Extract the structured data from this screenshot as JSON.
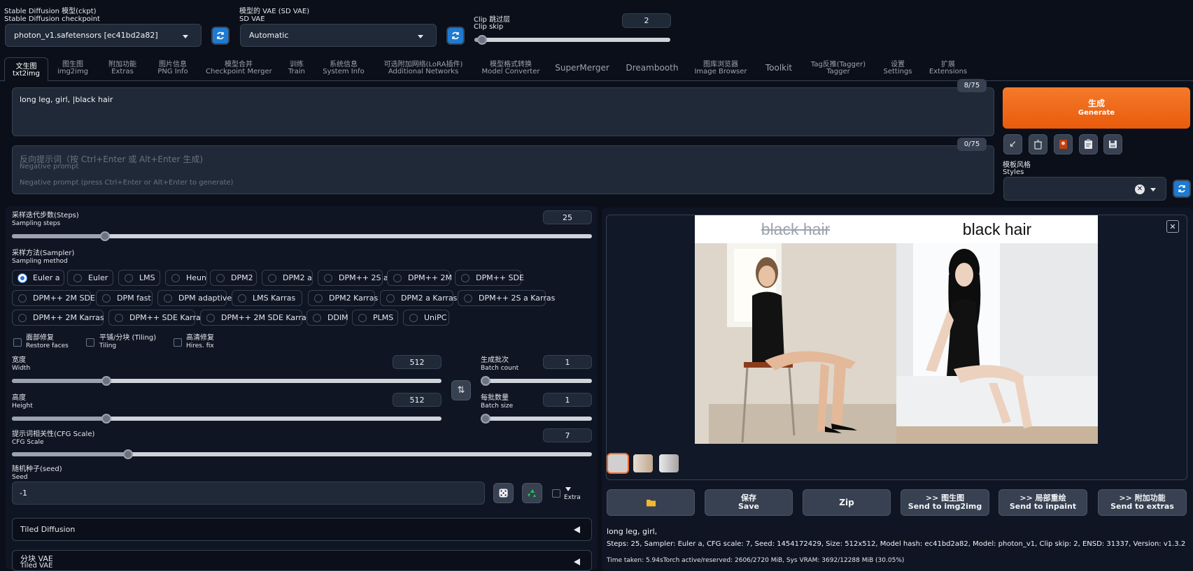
{
  "checkpoint": {
    "label_cn": "Stable Diffusion 模型(ckpt)",
    "label_en": "Stable Diffusion checkpoint",
    "value": "photon_v1.safetensors [ec41bd2a82]"
  },
  "vae": {
    "label_cn": "模型的 VAE (SD VAE)",
    "label_en": "SD VAE",
    "value": "Automatic"
  },
  "clip_skip": {
    "label_cn": "Clip 跳过层",
    "label_en": "Clip skip",
    "value": "2",
    "fraction": 0.04
  },
  "tabs": [
    {
      "cn": "文生图",
      "en": "txt2img"
    },
    {
      "cn": "图生图",
      "en": "img2img"
    },
    {
      "cn": "附加功能",
      "en": "Extras"
    },
    {
      "cn": "图片信息",
      "en": "PNG Info"
    },
    {
      "cn": "模型合并",
      "en": "Checkpoint Merger"
    },
    {
      "cn": "训练",
      "en": "Train"
    },
    {
      "cn": "系统信息",
      "en": "System Info"
    },
    {
      "cn": "可选附加网络(LoRA插件)",
      "en": "Additional Networks"
    },
    {
      "cn": "模型格式转换",
      "en": "Model Converter"
    },
    {
      "cn": "SuperMerger",
      "en": ""
    },
    {
      "cn": "Dreambooth",
      "en": ""
    },
    {
      "cn": "图库浏览器",
      "en": "Image Browser"
    },
    {
      "cn": "Toolkit",
      "en": ""
    },
    {
      "cn": "Tag反推(Tagger)",
      "en": "Tagger"
    },
    {
      "cn": "设置",
      "en": "Settings"
    },
    {
      "cn": "扩展",
      "en": "Extensions"
    }
  ],
  "prompt": {
    "value": "long leg, girl, |black hair",
    "counter": "8/75"
  },
  "negative_prompt": {
    "placeholder_cn": "反向提示词（按 Ctrl+Enter 或 Alt+Enter 生成)",
    "placeholder_label": "Negative prompt",
    "placeholder_en": "Negative prompt (press Ctrl+Enter or Alt+Enter to generate)",
    "counter": "0/75"
  },
  "generate": {
    "cn": "生成",
    "en": "Generate"
  },
  "styles": {
    "label_cn": "模板风格",
    "label_en": "Styles"
  },
  "steps": {
    "label_cn": "采样迭代步数(Steps)",
    "label_en": "Sampling steps",
    "value": "25",
    "fraction": 0.16
  },
  "sampler": {
    "label_cn": "采样方法(Sampler)",
    "label_en": "Sampling method",
    "selected": "Euler a",
    "options": [
      "Euler a",
      "Euler",
      "LMS",
      "Heun",
      "DPM2",
      "DPM2 a",
      "DPM++ 2S a",
      "DPM++ 2M",
      "DPM++ SDE",
      "DPM++ 2M SDE",
      "DPM fast",
      "DPM adaptive",
      "LMS Karras",
      "DPM2 Karras",
      "DPM2 a Karras",
      "DPM++ 2S a Karras",
      "DPM++ 2M Karras",
      "DPM++ SDE Karras",
      "DPM++ 2M SDE Karras",
      "DDIM",
      "PLMS",
      "UniPC"
    ]
  },
  "checks": {
    "restore_faces": {
      "cn": "面部修复",
      "en": "Restore faces"
    },
    "tiling": {
      "cn": "平铺/分块 (Tiling)",
      "en": "Tiling"
    },
    "hires": {
      "cn": "高清修复",
      "en": "Hires. fix"
    }
  },
  "width": {
    "label_cn": "宽度",
    "label_en": "Width",
    "value": "512",
    "fraction": 0.22
  },
  "height": {
    "label_cn": "高度",
    "label_en": "Height",
    "value": "512",
    "fraction": 0.22
  },
  "batch_count": {
    "label_cn": "生成批次",
    "label_en": "Batch count",
    "value": "1",
    "fraction": 0.0
  },
  "batch_size": {
    "label_cn": "每批数量",
    "label_en": "Batch size",
    "value": "1",
    "fraction": 0.0
  },
  "cfg": {
    "label_cn": "提示词相关性(CFG Scale)",
    "label_en": "CFG Scale",
    "value": "7",
    "fraction": 0.2
  },
  "seed": {
    "label_cn": "随机种子(seed)",
    "label_en": "Seed",
    "value": "-1",
    "extra": "Extra"
  },
  "accordions": [
    {
      "cn": "Tiled Diffusion",
      "en": ""
    },
    {
      "cn": "分块 VAE",
      "en": "Tiled VAE"
    }
  ],
  "preview": {
    "caption_left": "black hair",
    "caption_right": "black hair"
  },
  "action_buttons": [
    {
      "cn": "",
      "en": ""
    },
    {
      "cn": "保存",
      "en": "Save"
    },
    {
      "cn": "Zip",
      "en": ""
    },
    {
      "cn": ">> 图生图",
      "en": "Send to img2img"
    },
    {
      "cn": ">> 局部重绘",
      "en": "Send to inpaint"
    },
    {
      "cn": ">> 附加功能",
      "en": "Send to extras"
    }
  ],
  "info": {
    "prompt": "long leg, girl,",
    "params": "Steps: 25, Sampler: Euler a, CFG scale: 7, Seed: 1454172429, Size: 512x512, Model hash: ec41bd2a82, Model: photon_v1, Clip skip: 2, ENSD: 31337, Version: v1.3.2",
    "timing": "Time taken: 5.94sTorch active/reserved: 2606/2720 MiB, Sys VRAM: 3692/12288 MiB (30.05%)"
  },
  "colors": {
    "accent_orange": "#f26b1d",
    "refresh_blue": "#1e7bd3",
    "background": "#0b0f19"
  }
}
